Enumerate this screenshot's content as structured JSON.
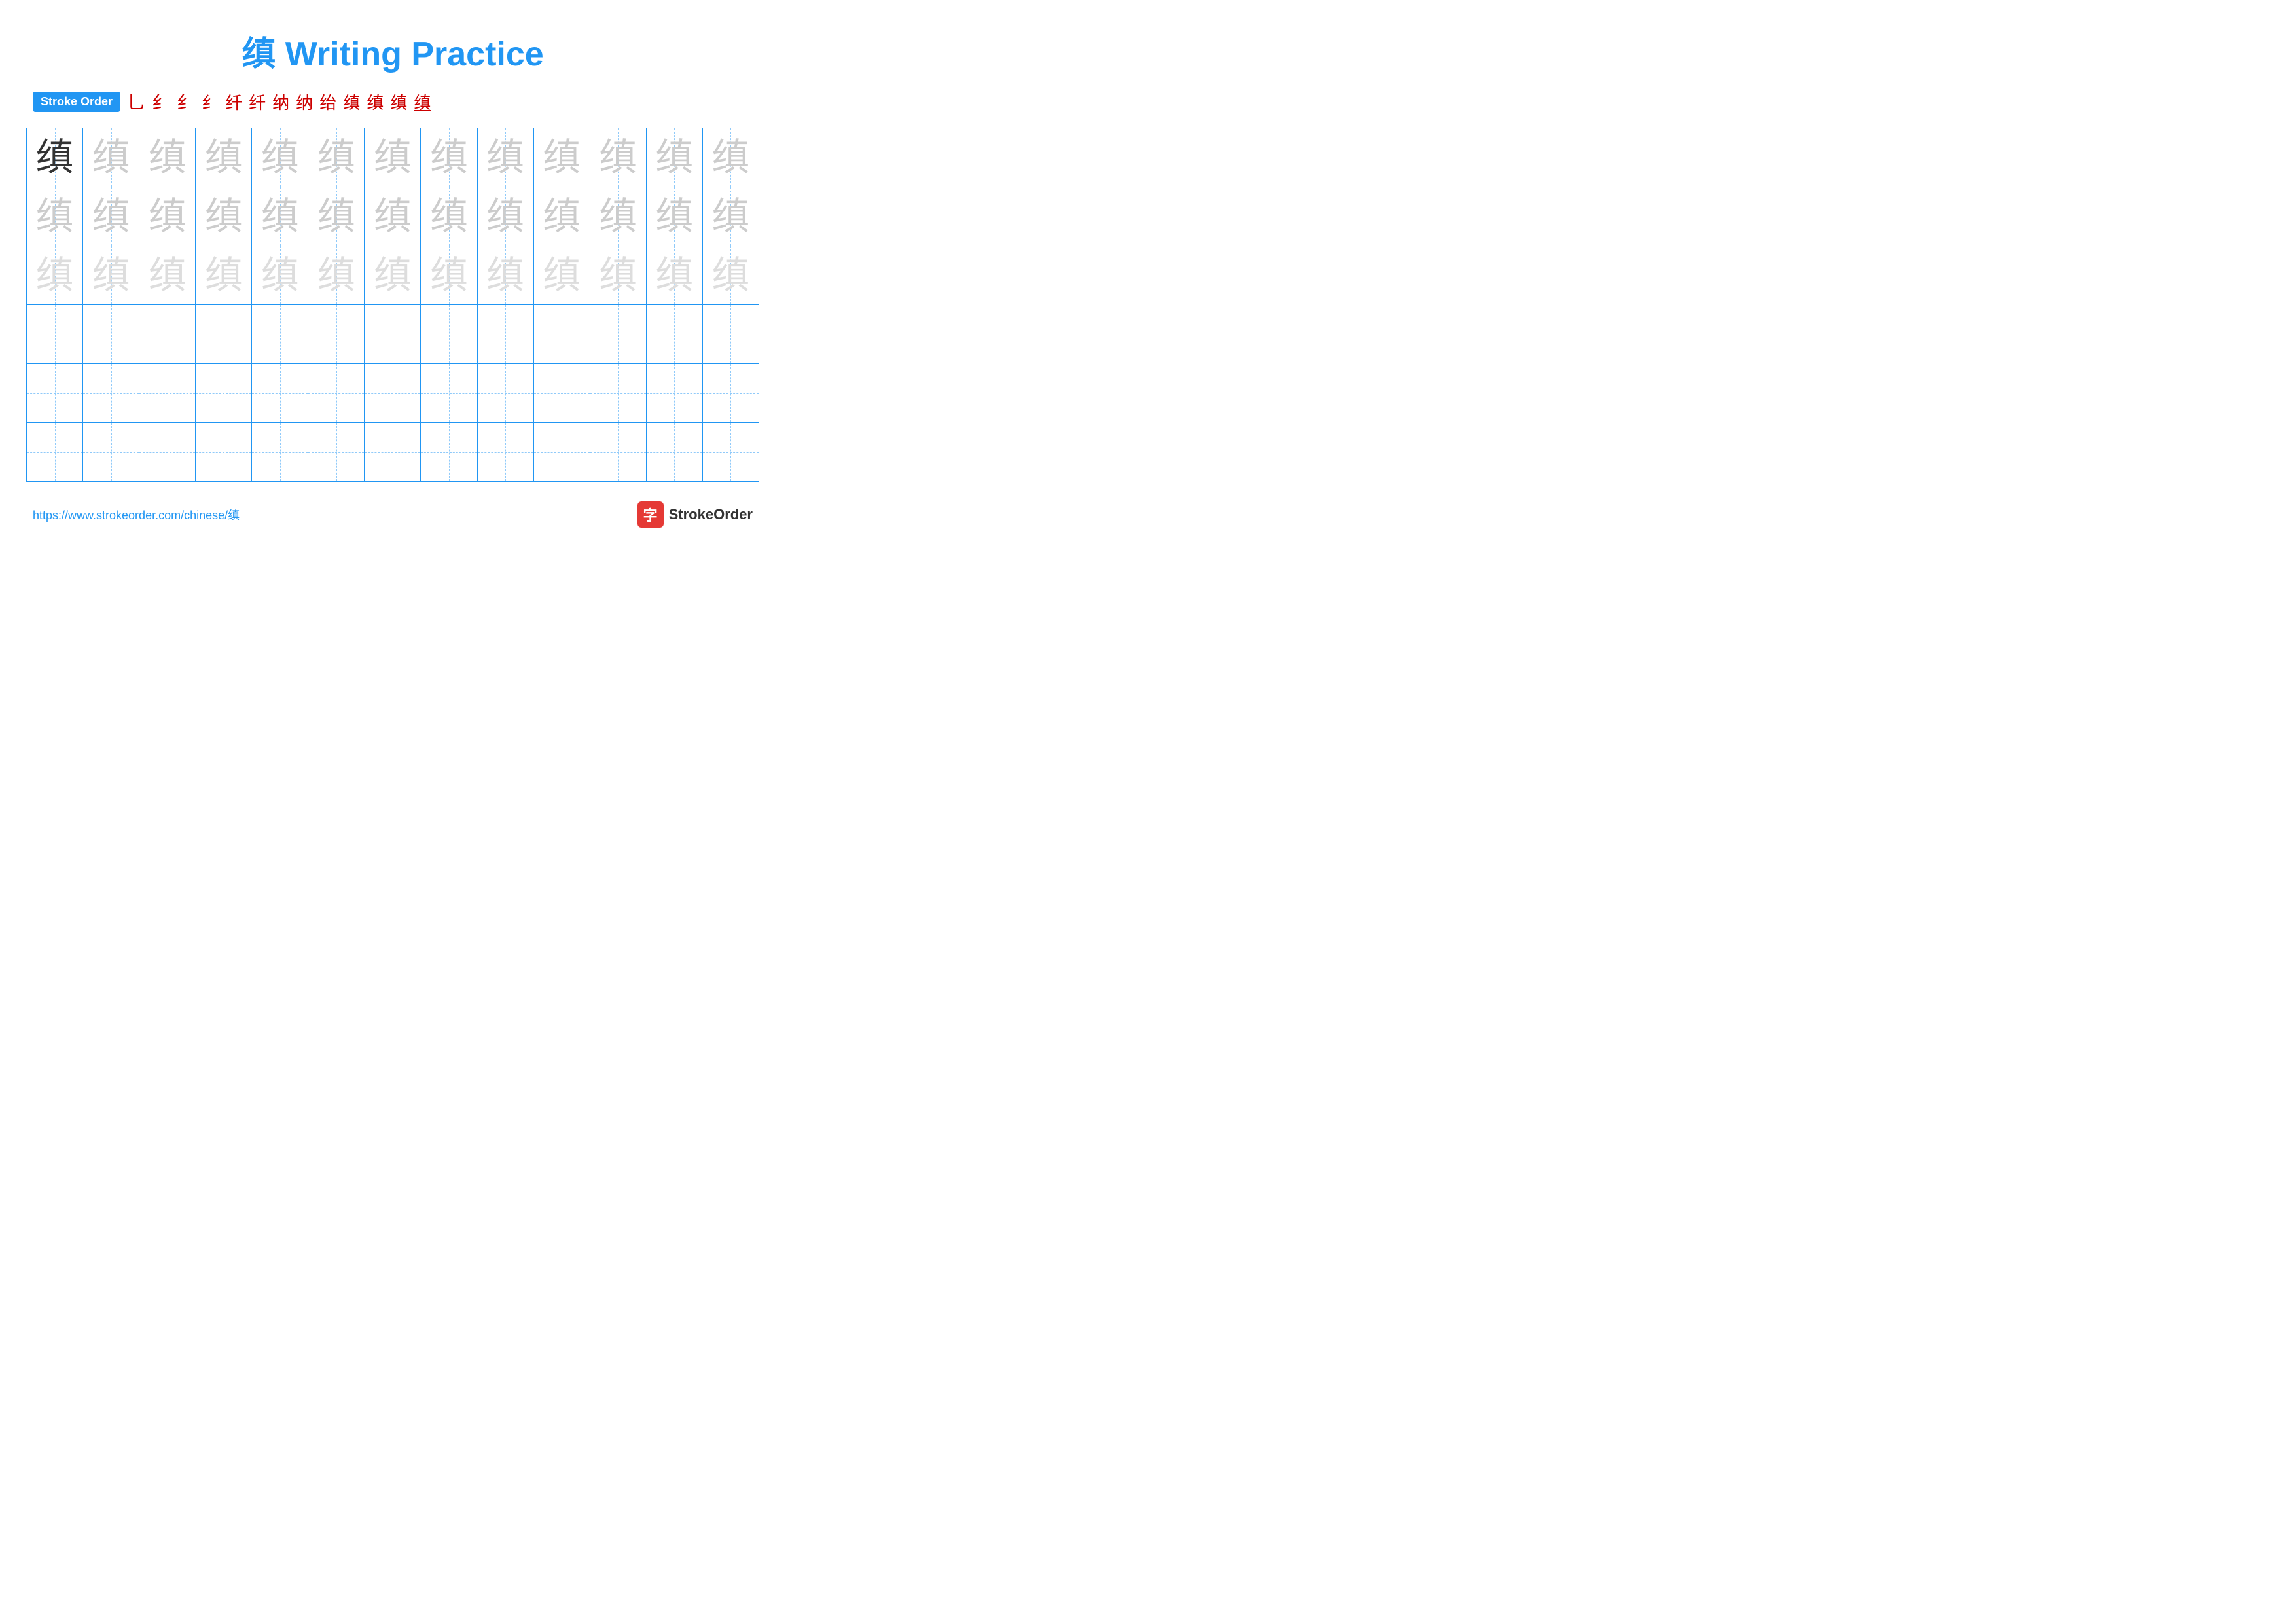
{
  "title": {
    "character": "缜",
    "suffix": " Writing Practice",
    "full": "缜 Writing Practice"
  },
  "stroke_order": {
    "badge_label": "Stroke Order",
    "steps": [
      "乚",
      "纟",
      "纟",
      "纟",
      "纟",
      "纤",
      "纳",
      "纳",
      "绐",
      "缜",
      "缜",
      "缜",
      "缜"
    ]
  },
  "grid": {
    "rows": 6,
    "cols": 13,
    "character": "缜",
    "dark_row": 0,
    "light_rows": [
      1,
      2
    ],
    "empty_rows": [
      3,
      4,
      5
    ],
    "light_col_start": 1
  },
  "footer": {
    "url": "https://www.strokeorder.com/chinese/缜",
    "logo_char": "字",
    "logo_text": "StrokeOrder"
  }
}
